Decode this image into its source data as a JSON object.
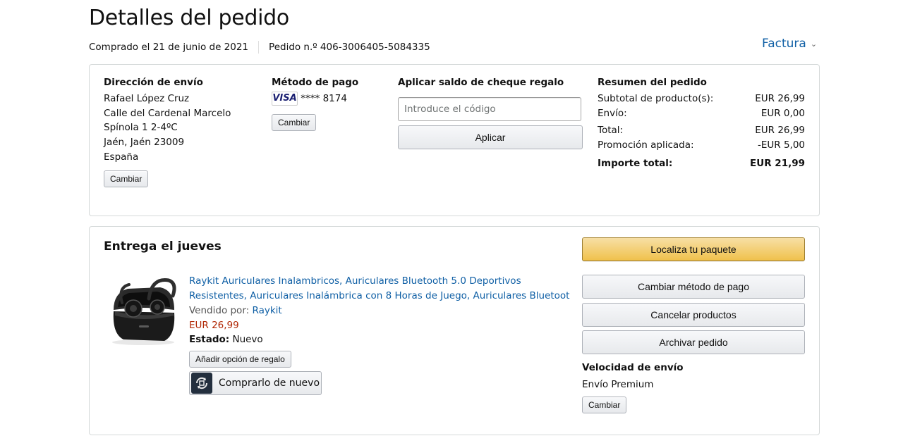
{
  "page": {
    "title": "Detalles del pedido",
    "ordered_date": "Comprado el 21 de junio de 2021",
    "order_number": "Pedido n.º 406-3006405-5084335",
    "invoice_label": "Factura"
  },
  "shipping_address": {
    "heading": "Dirección de envío",
    "lines": [
      "Rafael López Cruz",
      "Calle del Cardenal Marcelo",
      "Spínola 1 2-4ºC",
      "Jaén, Jaén 23009",
      "España"
    ],
    "change_label": "Cambiar"
  },
  "payment": {
    "heading": "Método de pago",
    "card_brand": "VISA",
    "card_masked": "**** 8174",
    "change_label": "Cambiar"
  },
  "gift_card": {
    "heading": "Aplicar saldo de cheque regalo",
    "placeholder": "Introduce el código",
    "apply_label": "Aplicar"
  },
  "summary": {
    "heading": "Resumen del pedido",
    "rows": [
      {
        "label": "Subtotal de producto(s):",
        "value": "EUR 26,99"
      },
      {
        "label": "Envío:",
        "value": "EUR 0,00"
      },
      {
        "label": "Total:",
        "value": "EUR 26,99"
      },
      {
        "label": "Promoción aplicada:",
        "value": "-EUR 5,00"
      }
    ],
    "grand_total": {
      "label": "Importe total:",
      "value": "EUR 21,99"
    }
  },
  "delivery": {
    "heading": "Entrega el jueves",
    "product": {
      "title_line1": "Raykit Auriculares Inalambricos, Auriculares Bluetooth 5.0 Deportivos",
      "title_line2": "Resistentes, Auriculares Inalámbrica con 8 Horas de Juego, Auriculares Bluetoot",
      "sold_by_label": "Vendido por:",
      "seller": "Raykit",
      "price": "EUR 26,99",
      "status_label": "Estado:",
      "status_value": "Nuevo",
      "gift_option_label": "Añadir opción de regalo",
      "buy_again_label": "Comprarlo de nuevo"
    },
    "actions": {
      "track": "Localiza tu paquete",
      "change_payment": "Cambiar método de pago",
      "cancel": "Cancelar productos",
      "archive": "Archivar pedido"
    },
    "shipping_speed": {
      "heading": "Velocidad de envío",
      "value": "Envío Premium",
      "change_label": "Cambiar"
    }
  },
  "colors": {
    "link": "#0f5fa5",
    "price": "#b12704",
    "primary_button": "#f0c14b",
    "border": "#d5d9d9"
  },
  "icons": [
    "chevron-down-icon",
    "visa-card-icon",
    "buy-again-icon",
    "product-image"
  ]
}
